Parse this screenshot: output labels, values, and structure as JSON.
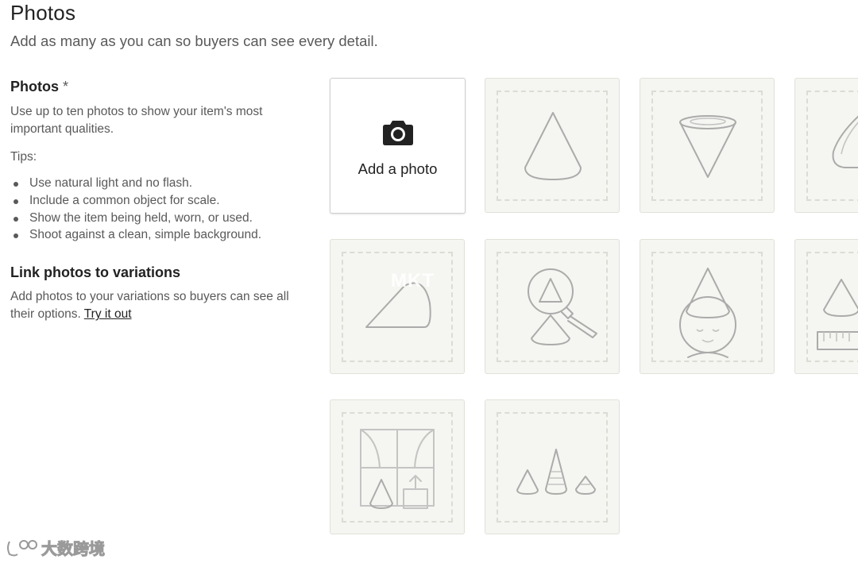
{
  "header": {
    "title": "Photos",
    "subtitle": "Add as many as you can so buyers can see every detail."
  },
  "photos_field": {
    "label": "Photos",
    "required_mark": "*",
    "help": "Use up to ten photos to show your item's most important qualities.",
    "tips_label": "Tips:",
    "tips": [
      "Use natural light and no flash.",
      "Include a common object for scale.",
      "Show the item being held, worn, or used.",
      "Shoot against a clean, simple background."
    ]
  },
  "variations": {
    "title": "Link photos to variations",
    "help": "Add photos to your variations so buyers can see all their options.",
    "link": "Try it out"
  },
  "uploader": {
    "add_label": "Add a photo",
    "add_icon": "camera-icon",
    "placeholders": [
      "cone-upright-icon",
      "cone-top-view-icon",
      "cone-angled-icon",
      "cone-tipped-icon",
      "cone-detail-magnifier-icon",
      "cone-worn-icon",
      "cone-scale-ruler-icon",
      "cone-in-setting-icon",
      "cone-group-icon"
    ]
  },
  "watermarks": {
    "center": "MKT",
    "corner": "大数跨境"
  }
}
